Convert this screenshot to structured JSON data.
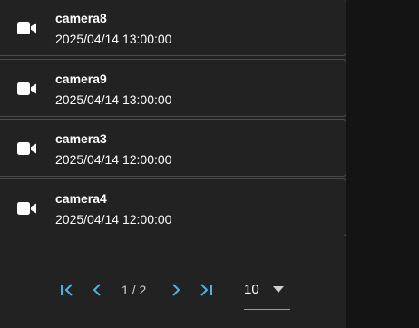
{
  "cameras": [
    {
      "name": "camera8",
      "time": "2025/04/14 13:00:00",
      "icon": "video-camera-icon"
    },
    {
      "name": "camera9",
      "time": "2025/04/14 13:00:00",
      "icon": "video-camera-icon"
    },
    {
      "name": "camera3",
      "time": "2025/04/14 12:00:00",
      "icon": "video-camera-icon"
    },
    {
      "name": "camera4",
      "time": "2025/04/14 12:00:00",
      "icon": "video-camera-icon"
    }
  ],
  "pagination": {
    "page_info": "1 / 2",
    "page_size": "10",
    "accent_color": "#4fb3e0"
  }
}
